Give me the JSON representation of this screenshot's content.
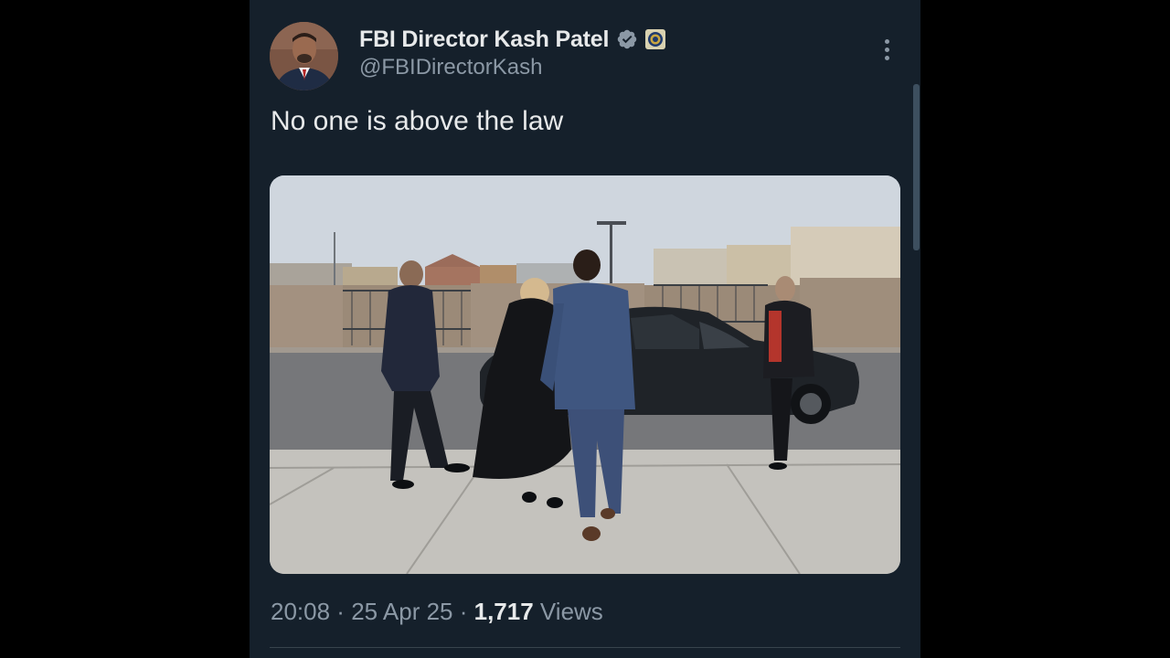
{
  "tweet": {
    "author": {
      "display_name": "FBI Director Kash Patel",
      "handle": "@FBIDirectorKash",
      "verified_icon": "verified-badge-icon",
      "affiliation_icon": "fbi-seal-icon"
    },
    "more_icon": "more-options-icon",
    "text": "No one is above the law",
    "media": {
      "type": "photo",
      "icon": "photo"
    },
    "time": "20:08",
    "separator": " · ",
    "date": "25 Apr 25",
    "views_count": "1,717",
    "views_label": "Views"
  },
  "colors": {
    "background": "#15202b",
    "outer_background": "#000000",
    "text_primary": "#e7e9ea",
    "text_secondary": "#8b98a5",
    "verified_badge": "#8b98a5"
  }
}
